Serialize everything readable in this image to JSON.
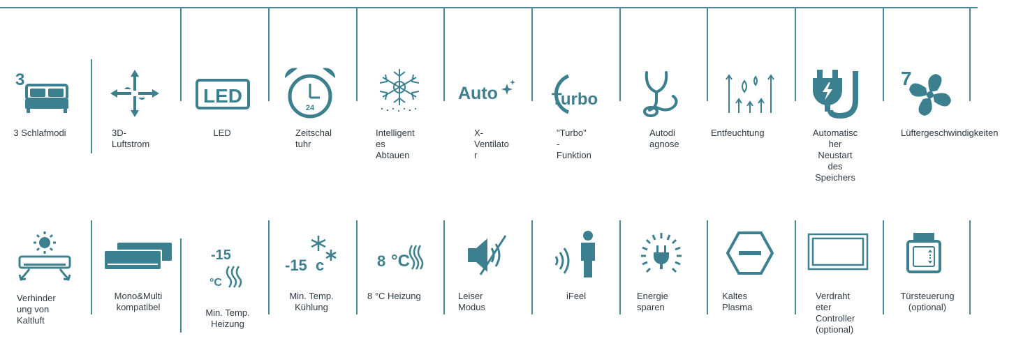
{
  "colors": {
    "accent": "#3c7f8e",
    "divider": "#4a8a96",
    "text": "#2e3a44"
  },
  "row1": [
    {
      "icon": "bed-icon",
      "badge": "3",
      "label": "3 Schlafmodi"
    },
    {
      "icon": "airflow-3d-icon",
      "label": "3D-\nLuftstrom"
    },
    {
      "icon": "led-icon",
      "badge": "LED",
      "label": "LED"
    },
    {
      "icon": "alarm-clock-icon",
      "badge": "24",
      "label": "Zeitschal\ntuhr"
    },
    {
      "icon": "snowflake-icon",
      "label": "Intelligent\nes\nAbtauen"
    },
    {
      "icon": "auto-icon",
      "badge": "Auto",
      "label": "X-\nVentilato\nr"
    },
    {
      "icon": "turbo-icon",
      "badge": "Turbo",
      "label": "\"Turbo\"\n-\nFunktion"
    },
    {
      "icon": "stethoscope-icon",
      "label": "Autodi\nagnose"
    },
    {
      "icon": "dehumidify-icon",
      "label": "Entfeuchtung"
    },
    {
      "icon": "power-plug-icon",
      "label": "Automatisc\nher\nNeustart\ndes\nSpeichers"
    },
    {
      "icon": "fan-icon",
      "badge": "7",
      "label": "Lüftergeschwindigkeiten"
    }
  ],
  "row2": [
    {
      "icon": "anti-cold-air-icon",
      "label": "Verhinder\nung von\nKaltluft"
    },
    {
      "icon": "multi-split-icon",
      "label": "Mono&Multi\nkompatibel"
    },
    {
      "icon": "min-temp-heating-icon",
      "badge": "-15",
      "unit": "°C",
      "label": "Min. Temp.\nHeizung"
    },
    {
      "icon": "min-temp-cooling-icon",
      "badge": "-15",
      "unit": "c",
      "label": "Min. Temp.\nKühlung"
    },
    {
      "icon": "heating-8c-icon",
      "badge": "8",
      "unit": "°C",
      "label": "8 °C Heizung"
    },
    {
      "icon": "mute-icon",
      "label": "Leiser\nModus"
    },
    {
      "icon": "ifeel-icon",
      "label": "iFeel"
    },
    {
      "icon": "energy-saving-icon",
      "label": "Energie\nsparen"
    },
    {
      "icon": "cold-plasma-icon",
      "label": "Kaltes\nPlasma"
    },
    {
      "icon": "wired-controller-icon",
      "label": "Verdraht\neter\nController\n(optional)"
    },
    {
      "icon": "door-control-icon",
      "label": "Türsteuerung\n(optional)"
    }
  ]
}
